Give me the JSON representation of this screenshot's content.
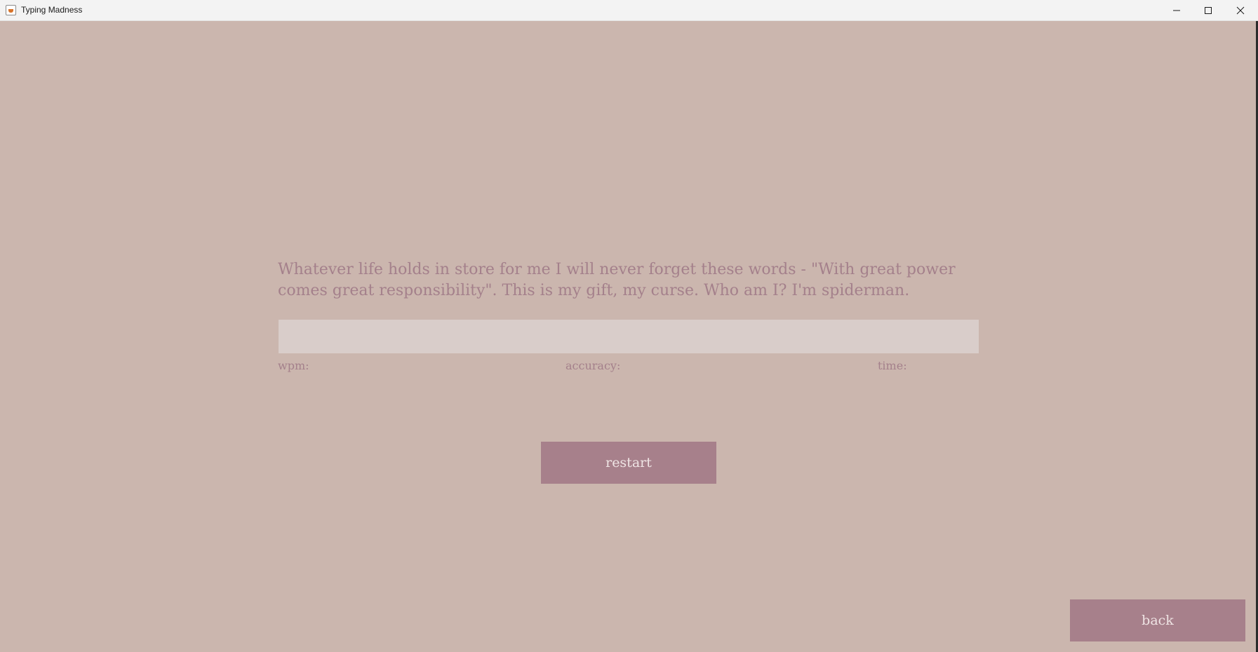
{
  "window": {
    "title": "Typing Madness",
    "icon": "java-app-icon",
    "controls": {
      "minimize_icon": "minimize-icon",
      "maximize_icon": "maximize-icon",
      "close_icon": "close-icon"
    }
  },
  "typing": {
    "prompt": "Whatever life holds in store for me I will never forget these words - \"With great power comes great responsibility\". This is my gift, my curse. Who am I? I'm spiderman.",
    "input_value": "",
    "input_placeholder": ""
  },
  "stats": {
    "wpm_label": "wpm:",
    "accuracy_label": "accuracy:",
    "time_label": "time:"
  },
  "buttons": {
    "restart_label": "restart",
    "back_label": "back"
  },
  "colors": {
    "background": "#cbb6ae",
    "accent": "#a7808b",
    "text": "#a4808b",
    "input_background": "#d9cdca",
    "button_text": "#efe4e4"
  }
}
